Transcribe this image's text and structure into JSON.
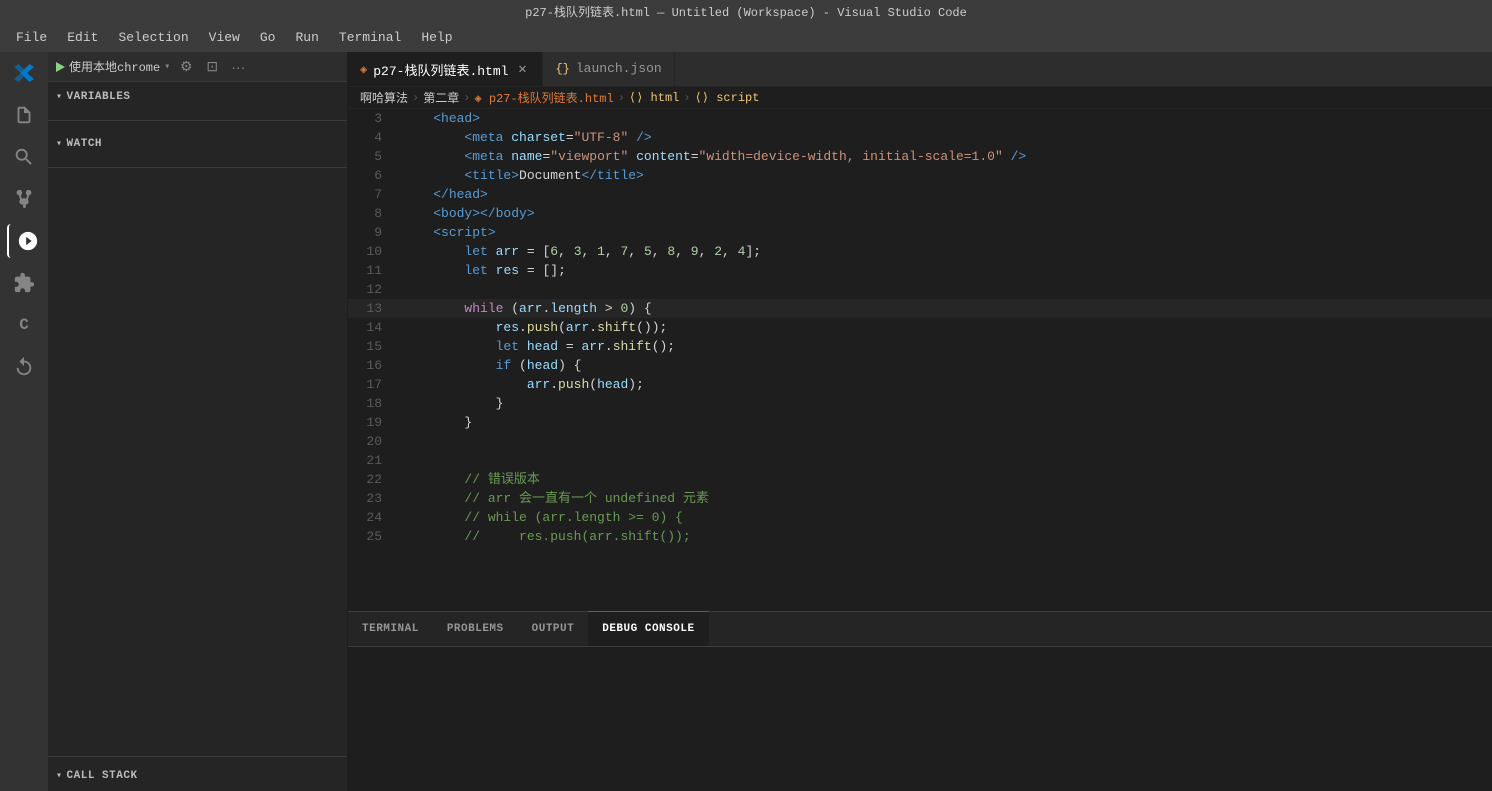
{
  "titleBar": {
    "text": "p27-栈队列链表.html — Untitled (Workspace) - Visual Studio Code"
  },
  "menuBar": {
    "items": [
      "File",
      "Edit",
      "Selection",
      "View",
      "Go",
      "Run",
      "Terminal",
      "Help"
    ]
  },
  "activityBar": {
    "icons": [
      {
        "name": "vscode-logo",
        "symbol": "⬡",
        "active": false
      },
      {
        "name": "explorer-icon",
        "symbol": "⎘",
        "active": false
      },
      {
        "name": "search-icon",
        "symbol": "🔍",
        "active": false
      },
      {
        "name": "source-control-icon",
        "symbol": "⑂",
        "active": false
      },
      {
        "name": "run-debug-icon",
        "symbol": "▷",
        "active": true
      },
      {
        "name": "extensions-icon",
        "symbol": "⊞",
        "active": false
      },
      {
        "name": "clangd-icon",
        "symbol": "C",
        "active": false
      },
      {
        "name": "source-control-2-icon",
        "symbol": "↺",
        "active": false
      }
    ]
  },
  "debugToolbar": {
    "runLabel": "使用本地chrome",
    "runDropdownSymbol": "▾",
    "settingsSymbol": "⚙",
    "openEditorSymbol": "⊡",
    "moreSymbol": "···"
  },
  "sidebar": {
    "variablesHeader": "VARIABLES",
    "watchHeader": "WATCH",
    "callStackHeader": "CALL STACK"
  },
  "breadcrumb": {
    "parts": [
      "啊哈算法",
      "第二章",
      "p27-栈队列链表.html",
      "html",
      "script"
    ]
  },
  "tabs": [
    {
      "label": "p27-栈队列链表.html",
      "type": "html",
      "active": true
    },
    {
      "label": "launch.json",
      "type": "json",
      "active": false
    }
  ],
  "panelTabs": [
    {
      "label": "TERMINAL",
      "active": false
    },
    {
      "label": "PROBLEMS",
      "active": false
    },
    {
      "label": "OUTPUT",
      "active": false
    },
    {
      "label": "DEBUG CONSOLE",
      "active": true
    }
  ],
  "codeLines": [
    {
      "num": "3",
      "tokens": [
        {
          "t": "    "
        },
        {
          "t": "<head>",
          "c": "tag"
        }
      ]
    },
    {
      "num": "4",
      "tokens": [
        {
          "t": "        "
        },
        {
          "t": "<meta ",
          "c": "tag"
        },
        {
          "t": "charset",
          "c": "attr"
        },
        {
          "t": "=",
          "c": "op"
        },
        {
          "t": "\"UTF-8\"",
          "c": "val"
        },
        {
          "t": " />",
          "c": "tag"
        }
      ]
    },
    {
      "num": "5",
      "tokens": [
        {
          "t": "        "
        },
        {
          "t": "<meta ",
          "c": "tag"
        },
        {
          "t": "name",
          "c": "attr"
        },
        {
          "t": "=",
          "c": "op"
        },
        {
          "t": "\"viewport\"",
          "c": "val"
        },
        {
          "t": " ",
          "c": "tag"
        },
        {
          "t": "content",
          "c": "attr"
        },
        {
          "t": "=",
          "c": "op"
        },
        {
          "t": "\"width=device-width, initial-scale=1.0\"",
          "c": "val"
        },
        {
          "t": " />",
          "c": "tag"
        }
      ]
    },
    {
      "num": "6",
      "tokens": [
        {
          "t": "        "
        },
        {
          "t": "<title>",
          "c": "tag"
        },
        {
          "t": "Document",
          "c": "punct"
        },
        {
          "t": "</title>",
          "c": "tag"
        }
      ]
    },
    {
      "num": "7",
      "tokens": [
        {
          "t": "    "
        },
        {
          "t": "</head>",
          "c": "tag"
        }
      ]
    },
    {
      "num": "8",
      "tokens": [
        {
          "t": "    "
        },
        {
          "t": "<body></body>",
          "c": "tag"
        }
      ]
    },
    {
      "num": "9",
      "tokens": [
        {
          "t": "    "
        },
        {
          "t": "<script>",
          "c": "tag"
        }
      ]
    },
    {
      "num": "10",
      "tokens": [
        {
          "t": "        "
        },
        {
          "t": "let ",
          "c": "kw"
        },
        {
          "t": "arr ",
          "c": "var"
        },
        {
          "t": "= [",
          "c": "punct"
        },
        {
          "t": "6",
          "c": "num"
        },
        {
          "t": ", ",
          "c": "punct"
        },
        {
          "t": "3",
          "c": "num"
        },
        {
          "t": ", ",
          "c": "punct"
        },
        {
          "t": "1",
          "c": "num"
        },
        {
          "t": ", ",
          "c": "punct"
        },
        {
          "t": "7",
          "c": "num"
        },
        {
          "t": ", ",
          "c": "punct"
        },
        {
          "t": "5",
          "c": "num"
        },
        {
          "t": ", ",
          "c": "punct"
        },
        {
          "t": "8",
          "c": "num"
        },
        {
          "t": ", ",
          "c": "punct"
        },
        {
          "t": "9",
          "c": "num"
        },
        {
          "t": ", ",
          "c": "punct"
        },
        {
          "t": "2",
          "c": "num"
        },
        {
          "t": ", ",
          "c": "punct"
        },
        {
          "t": "4",
          "c": "num"
        },
        {
          "t": "];",
          "c": "punct"
        }
      ]
    },
    {
      "num": "11",
      "tokens": [
        {
          "t": "        "
        },
        {
          "t": "let ",
          "c": "kw"
        },
        {
          "t": "res ",
          "c": "var"
        },
        {
          "t": "= [];",
          "c": "punct"
        }
      ]
    },
    {
      "num": "12",
      "tokens": []
    },
    {
      "num": "13",
      "tokens": [
        {
          "t": "        "
        },
        {
          "t": "while",
          "c": "kw2"
        },
        {
          "t": " (",
          "c": "punct"
        },
        {
          "t": "arr",
          "c": "var"
        },
        {
          "t": ".",
          "c": "punct"
        },
        {
          "t": "length",
          "c": "prop"
        },
        {
          "t": " > ",
          "c": "op"
        },
        {
          "t": "0",
          "c": "num"
        },
        {
          "t": ") {",
          "c": "punct"
        }
      ],
      "highlight": true
    },
    {
      "num": "14",
      "tokens": [
        {
          "t": "            "
        },
        {
          "t": "res",
          "c": "var"
        },
        {
          "t": ".",
          "c": "punct"
        },
        {
          "t": "push",
          "c": "fn"
        },
        {
          "t": "(",
          "c": "punct"
        },
        {
          "t": "arr",
          "c": "var"
        },
        {
          "t": ".",
          "c": "punct"
        },
        {
          "t": "shift",
          "c": "fn"
        },
        {
          "t": "());",
          "c": "punct"
        }
      ]
    },
    {
      "num": "15",
      "tokens": [
        {
          "t": "            "
        },
        {
          "t": "let ",
          "c": "kw"
        },
        {
          "t": "head ",
          "c": "var"
        },
        {
          "t": "= ",
          "c": "op"
        },
        {
          "t": "arr",
          "c": "var"
        },
        {
          "t": ".",
          "c": "punct"
        },
        {
          "t": "shift",
          "c": "fn"
        },
        {
          "t": "();",
          "c": "punct"
        }
      ]
    },
    {
      "num": "16",
      "tokens": [
        {
          "t": "            "
        },
        {
          "t": "if ",
          "c": "kw"
        },
        {
          "t": "(",
          "c": "punct"
        },
        {
          "t": "head",
          "c": "var"
        },
        {
          "t": ") {",
          "c": "punct"
        }
      ]
    },
    {
      "num": "17",
      "tokens": [
        {
          "t": "                "
        },
        {
          "t": "arr",
          "c": "var"
        },
        {
          "t": ".",
          "c": "punct"
        },
        {
          "t": "push",
          "c": "fn"
        },
        {
          "t": "(",
          "c": "punct"
        },
        {
          "t": "head",
          "c": "var"
        },
        {
          "t": ");",
          "c": "punct"
        }
      ]
    },
    {
      "num": "18",
      "tokens": [
        {
          "t": "            "
        },
        {
          "t": "}",
          "c": "punct"
        }
      ]
    },
    {
      "num": "19",
      "tokens": [
        {
          "t": "        "
        },
        {
          "t": "}",
          "c": "punct"
        }
      ]
    },
    {
      "num": "20",
      "tokens": []
    },
    {
      "num": "21",
      "tokens": []
    },
    {
      "num": "22",
      "tokens": [
        {
          "t": "        "
        },
        {
          "t": "// 错误版本",
          "c": "comment"
        }
      ]
    },
    {
      "num": "23",
      "tokens": [
        {
          "t": "        "
        },
        {
          "t": "// arr 会一直有一个 undefined 元素",
          "c": "comment"
        }
      ]
    },
    {
      "num": "24",
      "tokens": [
        {
          "t": "        "
        },
        {
          "t": "// while (arr.length >= 0) {",
          "c": "comment"
        }
      ]
    },
    {
      "num": "25",
      "tokens": [
        {
          "t": "        "
        },
        {
          "t": "//     res.push(arr.shift());",
          "c": "comment"
        }
      ]
    }
  ]
}
